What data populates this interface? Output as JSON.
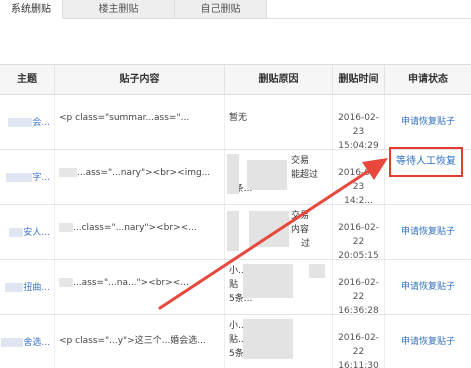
{
  "tabs": [
    {
      "label": "系统删贴",
      "active": true
    },
    {
      "label": "楼主删贴",
      "active": false
    },
    {
      "label": "自己删贴",
      "active": false
    }
  ],
  "table": {
    "headers": [
      "主题",
      "贴子内容",
      "删贴原因",
      "删贴时间",
      "申请状态"
    ],
    "rows": [
      {
        "topic_tail": "会...",
        "content": "<p class=\"summar...ass=\"...",
        "reason_lines": [
          "暂无"
        ],
        "date": "2016-02-23",
        "time": "15:04:29",
        "status": "申请恢复贴子"
      },
      {
        "topic_tail": "字...",
        "content": "...ass=\"...nary\"><br><img...",
        "reason_lines": [
          "小...",
          "交易",
          "能超过",
          "5条..."
        ],
        "date": "2016-02-23",
        "time": "14:2...",
        "status": "等待人工恢复"
      },
      {
        "topic_tail": "安人...",
        "content": "...class=\"...nary\"><br><...",
        "reason_lines": [
          "",
          "交易",
          "内容",
          "过"
        ],
        "date": "2016-02-22",
        "time": "20:05:15",
        "status": "申请恢复贴子"
      },
      {
        "topic_tail": "扭曲...",
        "content": "...ass=\"...na...\"><br><...",
        "reason_lines": [
          "小...",
          "贴",
          "5条..."
        ],
        "date": "2016-02-22",
        "time": "16:36:28",
        "status": "申请恢复贴子"
      },
      {
        "topic_tail": "舍选...",
        "content": "<p class=\"...y\">这三个...婚会选...",
        "reason_lines": [
          "小...",
          "贴...",
          "5条..."
        ],
        "date": "2016-02-22",
        "time": "16:11:30",
        "status": "申请恢复贴子"
      }
    ]
  },
  "colors": {
    "highlight_border": "#e03c31",
    "link": "#2f6fbf",
    "arrow": "#e8473c"
  }
}
